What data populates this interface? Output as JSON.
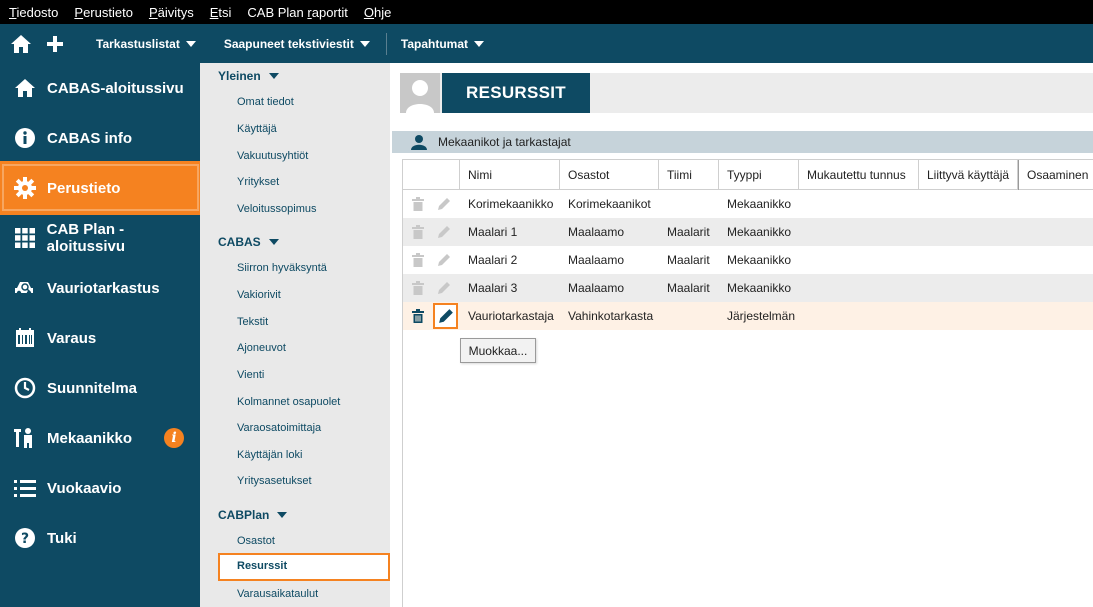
{
  "menubar": {
    "items": [
      {
        "label": "Tiedosto",
        "key": "T",
        "rest": "iedosto"
      },
      {
        "label": "Perustieto",
        "key": "P",
        "rest": "erustieto"
      },
      {
        "label": "Päivitys",
        "key": "P",
        "rest": "äivitys"
      },
      {
        "label": "Etsi",
        "key": "E",
        "rest": "tsi"
      },
      {
        "label": "CAB Plan raportit",
        "key_prefix": "CAB Plan ",
        "key": "r",
        "rest": "aportit"
      },
      {
        "label": "Ohje",
        "key": "O",
        "rest": "hje"
      }
    ]
  },
  "toolbar": {
    "home_icon": "home-icon",
    "add_icon": "plus-icon",
    "dropdowns": [
      "Tarkastuslistat",
      "Saapuneet tekstiviestit",
      "Tapahtumat"
    ]
  },
  "sidebar": {
    "items": [
      {
        "label": "CABAS-aloitussivu",
        "icon": "home-icon"
      },
      {
        "label": "CABAS info",
        "icon": "info-icon"
      },
      {
        "label": "Perustieto",
        "icon": "gear-icon",
        "active": true
      },
      {
        "label": "CAB Plan -aloitussivu",
        "icon": "grid-icon"
      },
      {
        "label": "Vauriotarkastus",
        "icon": "car-search-icon"
      },
      {
        "label": "Varaus",
        "icon": "calendar-icon"
      },
      {
        "label": "Suunnitelma",
        "icon": "clock-icon"
      },
      {
        "label": "Mekaanikko",
        "icon": "mechanic-icon",
        "badge": "i"
      },
      {
        "label": "Vuokaavio",
        "icon": "list-icon"
      },
      {
        "label": "Tuki",
        "icon": "help-icon"
      }
    ],
    "accent": "#f58220",
    "background": "#0e4a63"
  },
  "subnav": {
    "sections": [
      {
        "title": "Yleinen",
        "items": [
          "Omat tiedot",
          "Käyttäjä",
          "Vakuutusyhtiöt",
          "Yritykset",
          "Veloitussopimus"
        ]
      },
      {
        "title": "CABAS",
        "items": [
          "Siirron hyväksyntä",
          "Vakiorivit",
          "Tekstit",
          "Ajoneuvot",
          "Vienti",
          "Kolmannet osapuolet",
          "Varaosatoimittaja",
          "Käyttäjän loki",
          "Yritysasetukset"
        ]
      },
      {
        "title": "CABPlan",
        "items": [
          "Osastot",
          "Resurssit",
          "Varausaikataulut"
        ]
      }
    ],
    "active": "Resurssit"
  },
  "main": {
    "title": "RESURSSIT",
    "section": "Mekaanikot ja tarkastajat",
    "columns": [
      "Nimi",
      "Osastot",
      "Tiimi",
      "Tyyppi",
      "Mukautettu tunnus",
      "Liittyvä käyttäjä",
      "Osaaminen"
    ],
    "rows": [
      {
        "nimi": "Korimekaanikko",
        "osastot": "Korimekaanikot",
        "tiimi": "",
        "tyyppi": "Mekaanikko"
      },
      {
        "nimi": "Maalari 1",
        "osastot": "Maalaamo",
        "tiimi": "Maalarit",
        "tyyppi": "Mekaanikko"
      },
      {
        "nimi": "Maalari 2",
        "osastot": "Maalaamo",
        "tiimi": "Maalarit",
        "tyyppi": "Mekaanikko"
      },
      {
        "nimi": "Maalari 3",
        "osastot": "Maalaamo",
        "tiimi": "Maalarit",
        "tyyppi": "Mekaanikko"
      },
      {
        "nimi": "Vauriotarkastaja",
        "osastot": "Vahinkotarkasta",
        "tiimi": "",
        "tyyppi": "Järjestelmän"
      }
    ],
    "tooltip": "Muokkaa..."
  }
}
